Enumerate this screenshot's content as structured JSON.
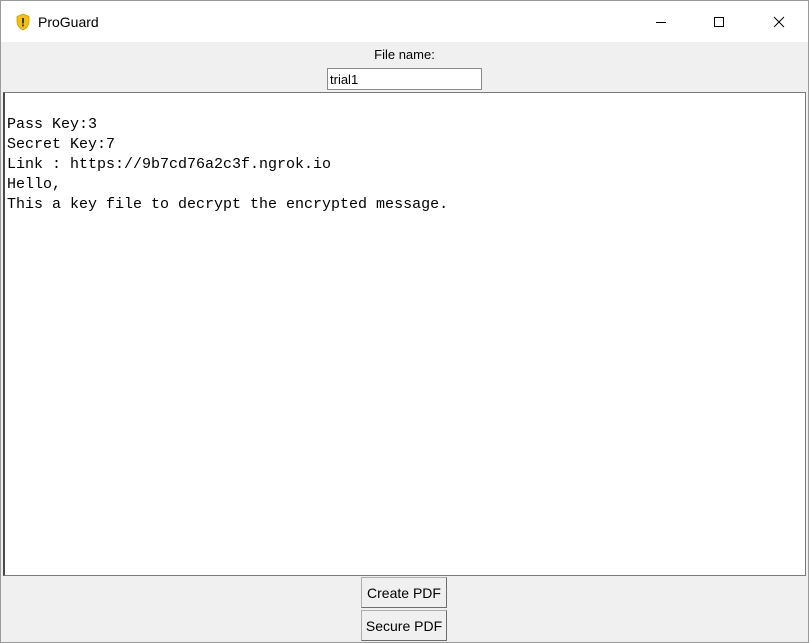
{
  "window": {
    "title": "ProGuard",
    "icon": "shield-icon",
    "controls": [
      "minimize-icon",
      "maximize-icon",
      "close-icon"
    ]
  },
  "file": {
    "label": "File name:",
    "value": "trial1"
  },
  "content": {
    "lines": [
      "Pass Key:3",
      "Secret Key:7",
      "Link : https://9b7cd76a2c3f.ngrok.io",
      "Hello,",
      "This a key file to decrypt the encrypted message."
    ]
  },
  "buttons": {
    "create": "Create PDF",
    "secure": "Secure PDF"
  },
  "colors": {
    "shield": "#f2c014",
    "shield_mark": "#3a2a00"
  }
}
